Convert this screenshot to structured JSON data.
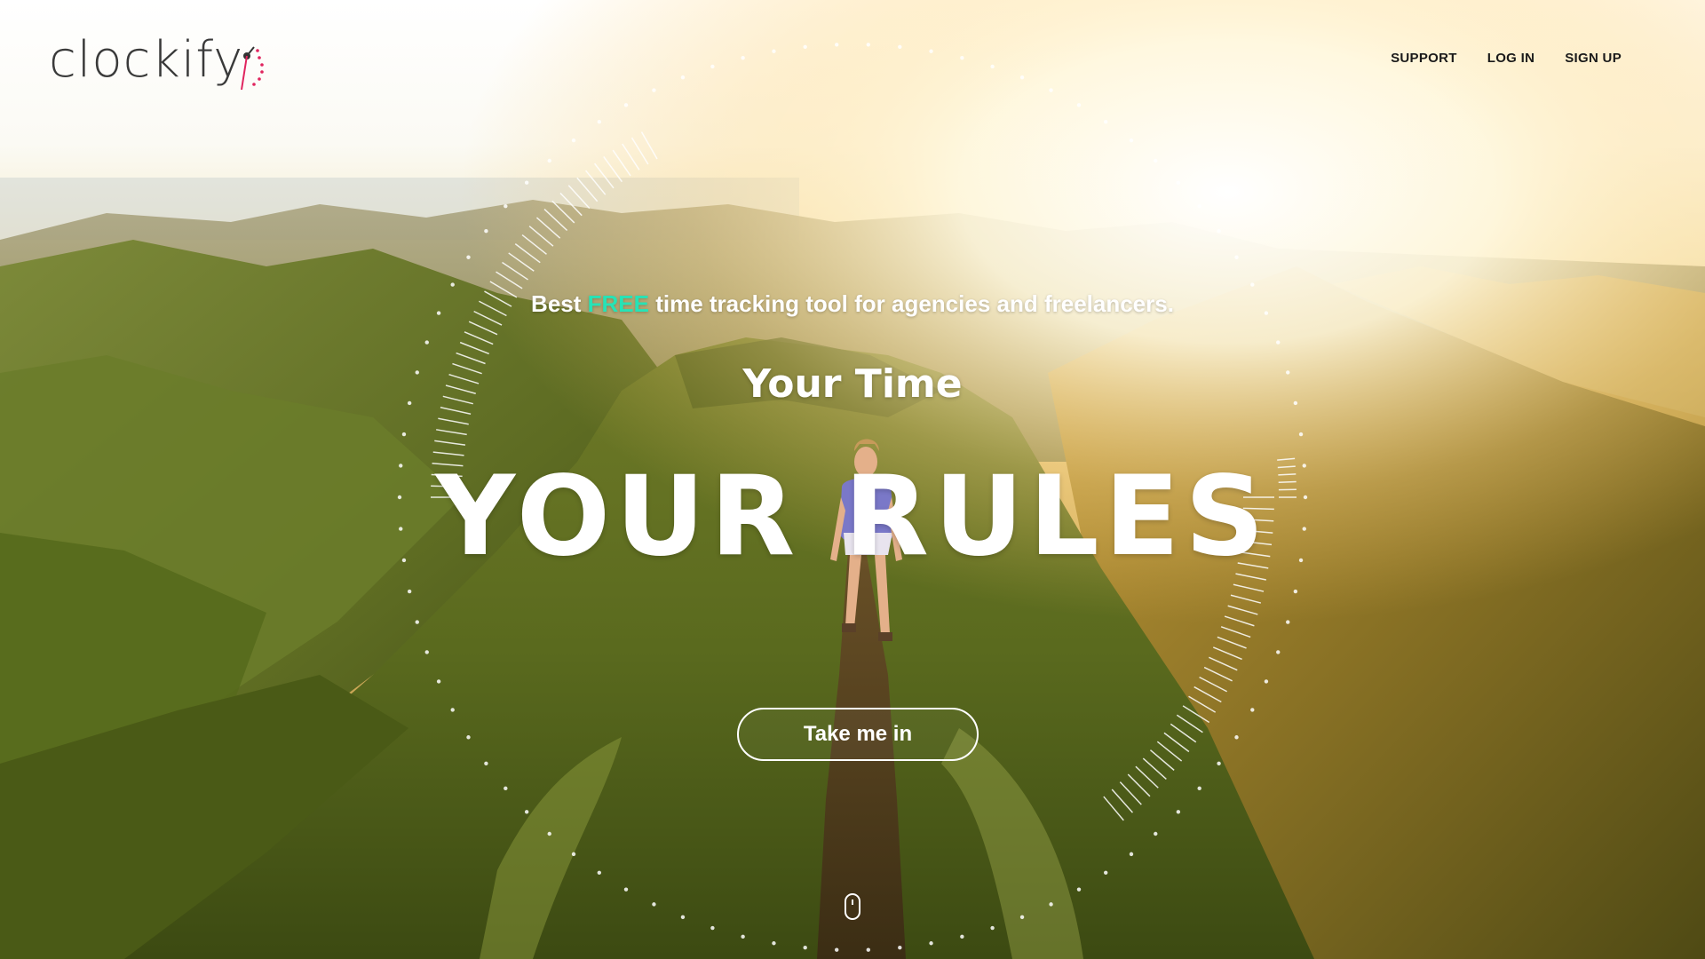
{
  "brand": {
    "name": "clockify",
    "accent_color": "#e0245e"
  },
  "nav": {
    "items": [
      {
        "label": "SUPPORT"
      },
      {
        "label": "LOG IN"
      },
      {
        "label": "SIGN UP"
      }
    ]
  },
  "hero": {
    "tagline_prefix": "Best ",
    "tagline_highlight": "FREE",
    "tagline_suffix": " time tracking tool for agencies and freelancers.",
    "highlight_color": "#26e3b6",
    "subtitle": "Your Time",
    "title": "YOUR RULES",
    "cta_label": "Take me in"
  },
  "icons": {
    "logo_clock": "clock-icon",
    "scroll": "mouse-scroll-icon",
    "dial": "clock-dial-decoration"
  }
}
